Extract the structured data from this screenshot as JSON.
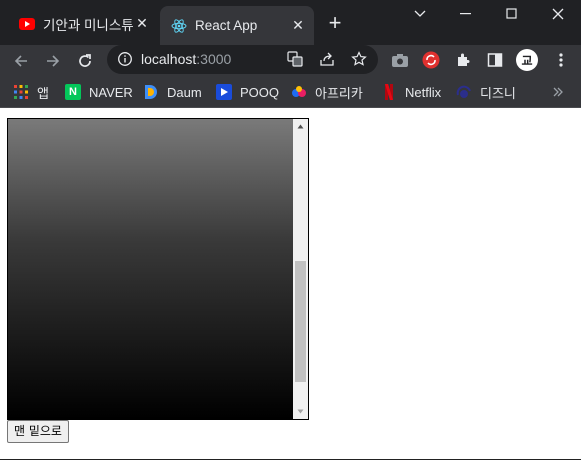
{
  "browser": {
    "tabs": [
      {
        "title": "기안과 미니스튜",
        "favicon": "youtube-icon",
        "active": false
      },
      {
        "title": "React App",
        "favicon": "react-icon",
        "active": true
      }
    ],
    "new_tab_label": "+",
    "address": {
      "host": "localhost",
      "port": ":3000"
    },
    "bookmarks": [
      {
        "label": "앱",
        "icon": "apps-grid-icon"
      },
      {
        "label": "NAVER",
        "icon": "naver-icon",
        "color": "#03c75a"
      },
      {
        "label": "Daum",
        "icon": "daum-icon"
      },
      {
        "label": "POOQ",
        "icon": "pooq-icon",
        "color": "#1a4cdb"
      },
      {
        "label": "아프리카",
        "icon": "afreeca-icon"
      },
      {
        "label": "Netflix",
        "icon": "netflix-icon",
        "color": "#e50914"
      },
      {
        "label": "디즈니",
        "icon": "disney-icon",
        "color": "#2b2e8c"
      }
    ],
    "profile_initial": "교",
    "colors": {
      "titlebar": "#202124",
      "toolbar": "#35363a",
      "text": "#e8eaed"
    }
  },
  "page": {
    "scroll_box": {
      "scroll_position": 0.85
    },
    "scroll_bottom_button": "맨 밑으로"
  }
}
